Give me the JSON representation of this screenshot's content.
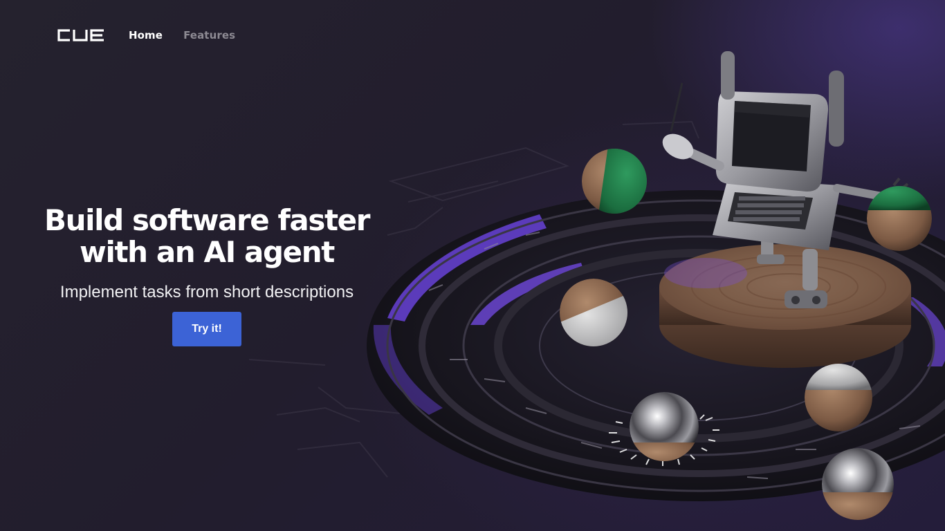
{
  "nav": {
    "logo_text": "CUE",
    "items": [
      {
        "label": "Home",
        "active": true
      },
      {
        "label": "Features",
        "active": false
      }
    ]
  },
  "hero": {
    "title_line1": "Build software faster",
    "title_line2": "with an AI agent",
    "subtitle": "Implement tasks from short descriptions",
    "cta_label": "Try it!"
  },
  "colors": {
    "background": "#231f2d",
    "accent_purple": "#6e4fdc",
    "cta_blue": "#3c63d6",
    "nav_active": "#ffffff",
    "nav_inactive": "#8d8a93"
  },
  "illustration": {
    "subject": "retro-computer-robot-conductor-on-wooden-pedestal",
    "spheres": [
      "green-wood-sphere",
      "gray-wood-sphere",
      "chrome-wood-sphere"
    ]
  }
}
